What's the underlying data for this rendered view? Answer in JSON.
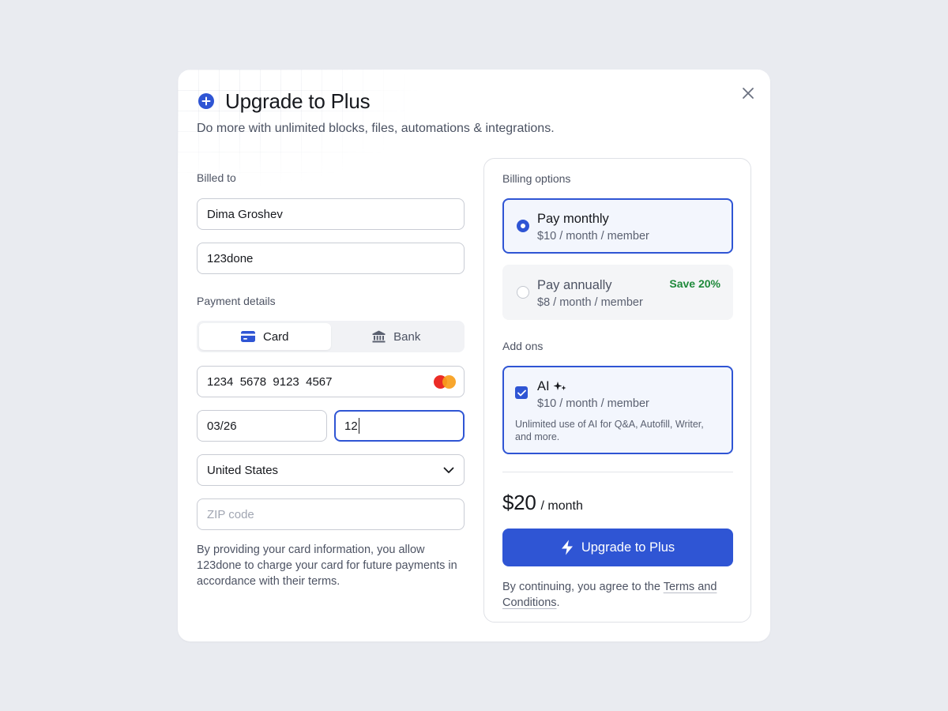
{
  "dialog": {
    "title": "Upgrade to Plus",
    "subtitle": "Do more with unlimited blocks, files, automations & integrations.",
    "header_icon": "plus-circle-icon",
    "close_icon": "close-icon"
  },
  "billing": {
    "label": "Billed to",
    "name_value": "Dima Groshev",
    "company_value": "123done"
  },
  "payment": {
    "label": "Payment details",
    "tabs": [
      {
        "label": "Card",
        "icon": "credit-card-icon",
        "active": true
      },
      {
        "label": "Bank",
        "icon": "bank-icon",
        "active": false
      }
    ],
    "card_number": "1234  5678  9123  4567",
    "card_brand_icon": "mastercard-icon",
    "expiry": "03/26",
    "cvc": "12",
    "country": "United States",
    "zip_placeholder": "ZIP code",
    "legal_text": "By providing your card information, you allow 123done to charge your card for future payments in accordance with their terms."
  },
  "billing_options": {
    "label": "Billing options",
    "options": [
      {
        "title": "Pay monthly",
        "price": "$10 / month / member",
        "selected": true
      },
      {
        "title": "Pay annually",
        "price": "$8 / month / member",
        "badge": "Save 20%",
        "selected": false
      }
    ]
  },
  "addons": {
    "label": "Add ons",
    "items": [
      {
        "title": "AI",
        "icon": "sparkles-icon",
        "price": "$10 / month / member",
        "description": "Unlimited use of AI for Q&A, Autofill, Writer, and more.",
        "checked": true
      }
    ]
  },
  "summary": {
    "amount": "$20",
    "period": "/ month",
    "cta_label": "Upgrade to Plus",
    "cta_icon": "lightning-icon",
    "agree_prefix": "By continuing, you agree to the ",
    "agree_link": "Terms and Conditions",
    "agree_suffix": "."
  },
  "colors": {
    "accent": "#2f55d4",
    "success": "#1f8a3b",
    "background": "#e9ebf0"
  }
}
